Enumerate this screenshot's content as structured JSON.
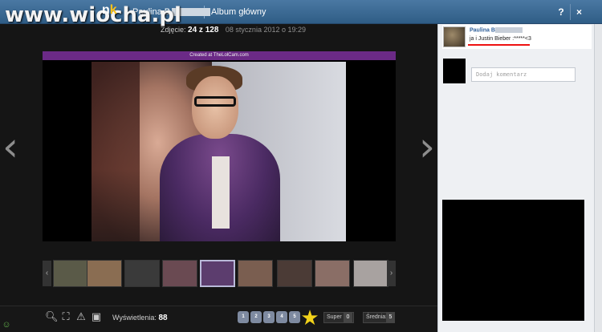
{
  "watermark": "www.wiocha.pl",
  "topbar": {
    "logo_n": "n",
    "logo_k": "k",
    "owner_prefix": "Paulina B",
    "album": "Album główny",
    "help": "?",
    "close": "×"
  },
  "photo_info": {
    "label": "Zdjęcie:",
    "position": "24 z 128",
    "date": "08 stycznia 2012 o 19:29"
  },
  "photo": {
    "banner": "Created at TheLolCam.com"
  },
  "navigation": {
    "prev_arrow": "‹",
    "next_arrow": "›",
    "thumb_prev": "‹",
    "thumb_next": "›"
  },
  "thumbnails": [
    {
      "color": "#5a5a48"
    },
    {
      "color": "#8a6d52"
    },
    {
      "color": "#3a3a3a"
    },
    {
      "color": "#6a4a52"
    },
    {
      "color": "#5c3d6e"
    },
    {
      "color": "#7a5e50"
    },
    {
      "color": "#4b3b36"
    },
    {
      "color": "#8a6e66"
    },
    {
      "color": "#a8a2a0"
    },
    {
      "color": "#4c4c4c"
    }
  ],
  "stats": {
    "views_label": "Wyświetlenia:",
    "views": "88",
    "super_label": "Super",
    "super_count": "0",
    "avg_label": "Średnia:",
    "avg_value": "5"
  },
  "rating": [
    "1",
    "2",
    "3",
    "4",
    "5"
  ],
  "caption": {
    "author": "Paulina B",
    "text": "ja i Justin Bieber :*****<3"
  },
  "comment": {
    "placeholder": "Dodaj komentarz"
  },
  "colors": {
    "topbar": "#3b6a94",
    "link": "#2f5f99",
    "highlight": "#e11111"
  }
}
